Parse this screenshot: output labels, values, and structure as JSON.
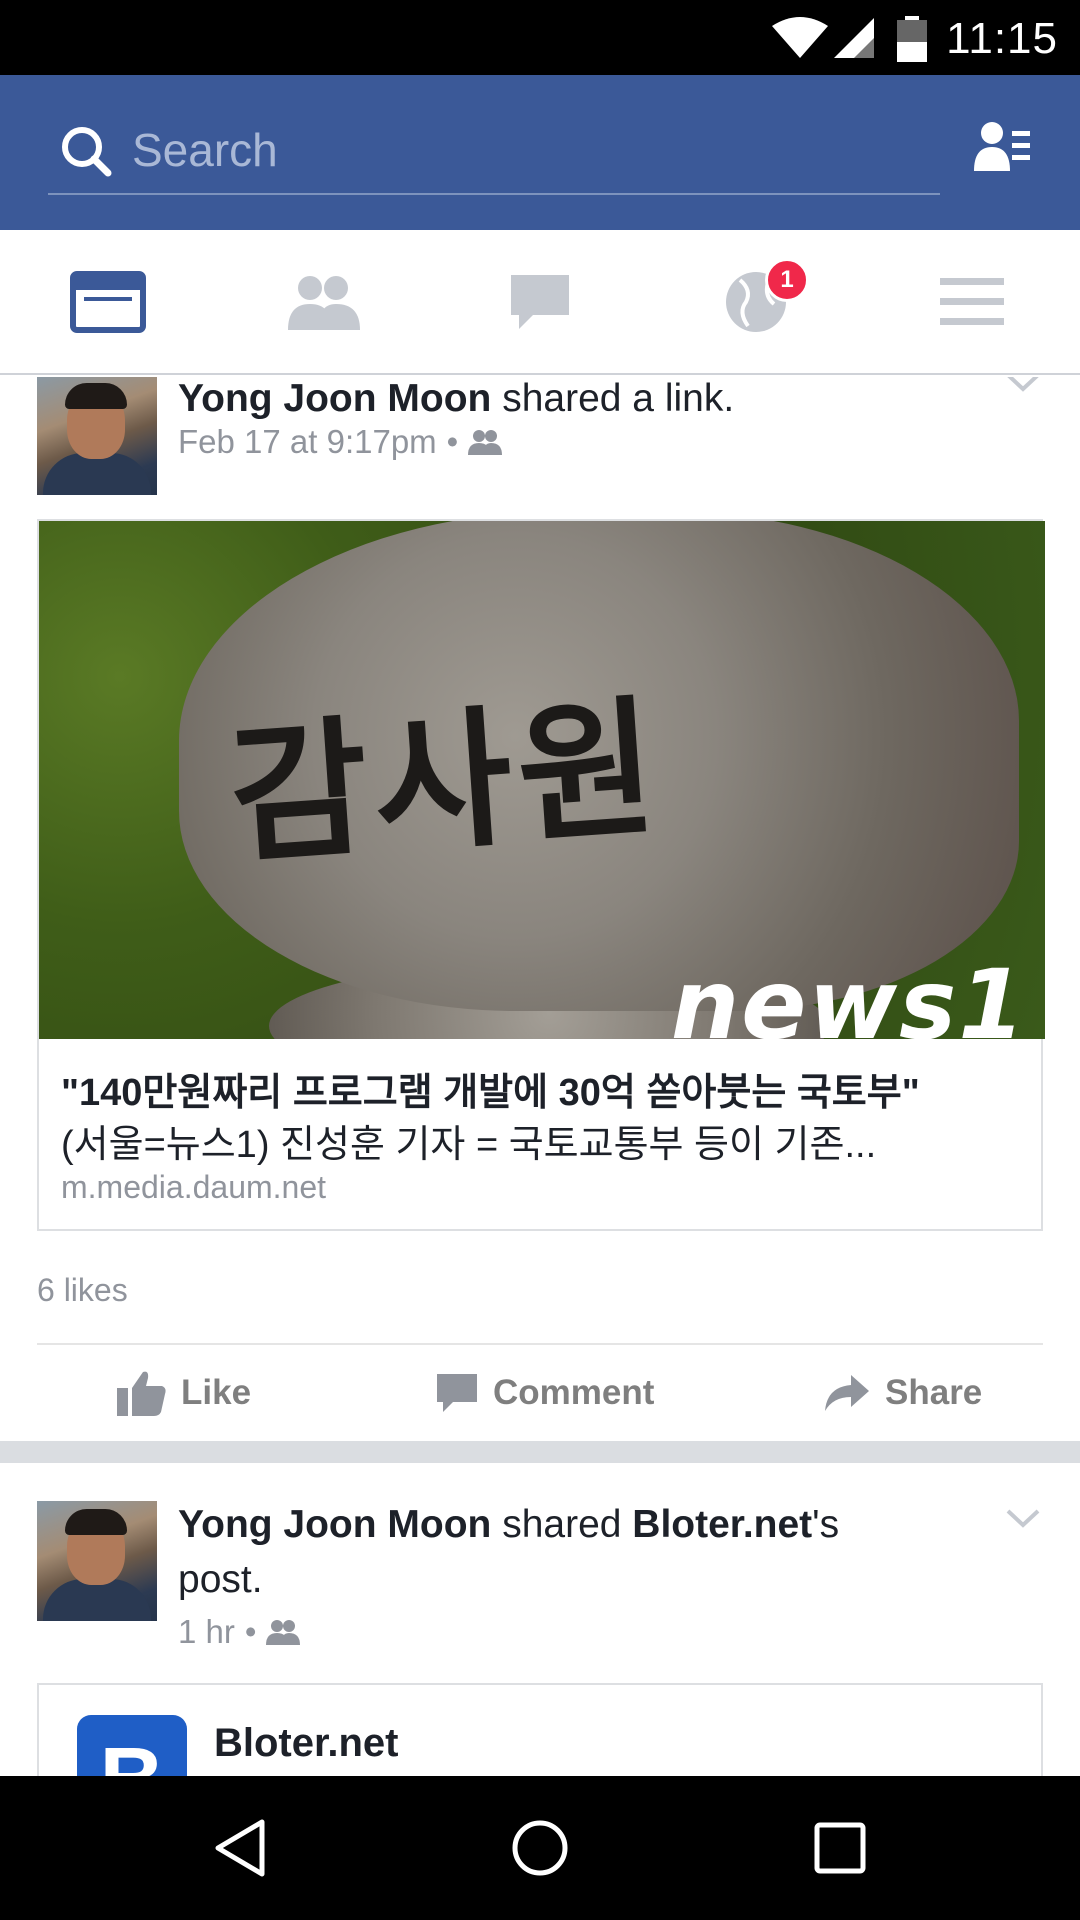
{
  "status_bar": {
    "time": "11:15"
  },
  "search": {
    "placeholder": "Search"
  },
  "tabs": [
    {
      "name": "news-feed",
      "active": true
    },
    {
      "name": "friend-requests",
      "active": false
    },
    {
      "name": "messages",
      "active": false
    },
    {
      "name": "notifications",
      "active": false,
      "badge": "1"
    },
    {
      "name": "more",
      "active": false
    }
  ],
  "colors": {
    "brand": "#3b5998",
    "badge": "#f0284a",
    "muted": "#90949c"
  },
  "posts": [
    {
      "author": "Yong Joon Moon",
      "action": " shared a link.",
      "time": "Feb 17 at 9:17pm",
      "separator": "•",
      "link": {
        "image_text": "감사원",
        "image_watermark": "news1",
        "title": "\"140만원짜리 프로그램 개발에 30억 쏟아붓는 국토부\"",
        "description": "(서울=뉴스1) 진성훈 기자 = 국토교통부 등이 기존...",
        "domain": "m.media.daum.net"
      },
      "likes": "6 likes",
      "actions": {
        "like": "Like",
        "comment": "Comment",
        "share": "Share"
      }
    },
    {
      "author": "Yong Joon Moon",
      "action": " shared ",
      "page": "Bloter.net",
      "action_suffix": "'s",
      "action_line2": "post.",
      "time": "1 hr",
      "separator": "•",
      "shared_page": {
        "logo_letter": "B",
        "name": "Bloter.net"
      }
    }
  ]
}
